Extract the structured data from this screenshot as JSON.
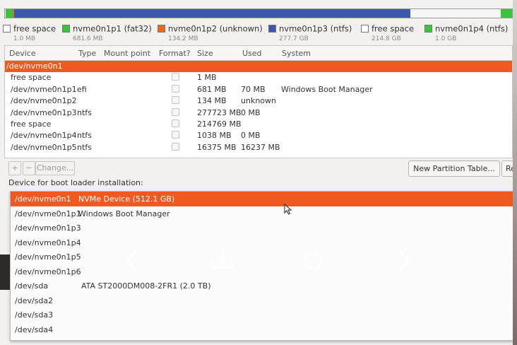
{
  "partition_bar": [
    {
      "color": "#f5f5f5",
      "fraction": 0.002
    },
    {
      "color": "#3cc33c",
      "fraction": 0.013
    },
    {
      "color": "#e66b1e",
      "fraction": 0.003
    },
    {
      "color": "#3b58ad",
      "fraction": 0.781
    },
    {
      "color": "#f5f5f5",
      "fraction": 0.179
    },
    {
      "color": "#3cc33c",
      "fraction": 0.022
    }
  ],
  "legend": [
    {
      "name": "free space",
      "size": "1.0 MB",
      "color": "#ffffff"
    },
    {
      "name": "nvme0n1p1 (fat32)",
      "size": "681.6 MB",
      "color": "#3cc33c"
    },
    {
      "name": "nvme0n1p2 (unknown)",
      "size": "134.2 MB",
      "color": "#e66b1e"
    },
    {
      "name": "nvme0n1p3 (ntfs)",
      "size": "277.7 GB",
      "color": "#3b58ad"
    },
    {
      "name": "free space",
      "size": "214.8 GB",
      "color": "#ffffff"
    },
    {
      "name": "nvme0n1p4 (ntfs)",
      "size": "1.0 GB",
      "color": "#3cc33c"
    }
  ],
  "table": {
    "headers": {
      "device": "Device",
      "type": "Type",
      "mount": "Mount point",
      "format": "Format?",
      "size": "Size",
      "used": "Used",
      "system": "System"
    },
    "rows": [
      {
        "device": "/dev/nvme0n1",
        "type": "",
        "size": "",
        "used": "",
        "system": ""
      },
      {
        "device": "free space",
        "type": "",
        "size": "1 MB",
        "used": "",
        "system": ""
      },
      {
        "device": "/dev/nvme0n1p1",
        "type": "efi",
        "size": "681 MB",
        "used": "70 MB",
        "system": "Windows Boot Manager"
      },
      {
        "device": "/dev/nvme0n1p2",
        "type": "",
        "size": "134 MB",
        "used": "unknown",
        "system": ""
      },
      {
        "device": "/dev/nvme0n1p3",
        "type": "ntfs",
        "size": "277723 MB",
        "used": "0 MB",
        "system": ""
      },
      {
        "device": "free space",
        "type": "",
        "size": "214769 MB",
        "used": "",
        "system": ""
      },
      {
        "device": "/dev/nvme0n1p4",
        "type": "ntfs",
        "size": "1038 MB",
        "used": "0 MB",
        "system": ""
      },
      {
        "device": "/dev/nvme0n1p5",
        "type": "ntfs",
        "size": "16375 MB",
        "used": "16237 MB",
        "system": ""
      }
    ]
  },
  "toolbar": {
    "add": "+",
    "remove": "−",
    "change": "Change...",
    "new_table": "New Partition Table...",
    "revert": "Revert"
  },
  "boot_loader": {
    "label": "Device for boot loader installation:",
    "options": [
      {
        "device": "/dev/nvme0n1",
        "desc": "NVMe Device (512.1 GB)"
      },
      {
        "device": "/dev/nvme0n1p1",
        "desc": "Windows Boot Manager"
      },
      {
        "device": "/dev/nvme0n1p3",
        "desc": ""
      },
      {
        "device": "/dev/nvme0n1p4",
        "desc": ""
      },
      {
        "device": "/dev/nvme0n1p5",
        "desc": ""
      },
      {
        "device": "/dev/nvme0n1p6",
        "desc": ""
      },
      {
        "device": "/dev/sda",
        "desc": "ATA ST2000DM008-2FR1 (2.0 TB)"
      },
      {
        "device": "/dev/sda2",
        "desc": ""
      },
      {
        "device": "/dev/sda3",
        "desc": ""
      },
      {
        "device": "/dev/sda4",
        "desc": ""
      }
    ]
  },
  "viewer_controls": {
    "prev": "previous-icon",
    "download": "download-icon",
    "rotate": "rotate-icon",
    "next": "next-icon"
  }
}
